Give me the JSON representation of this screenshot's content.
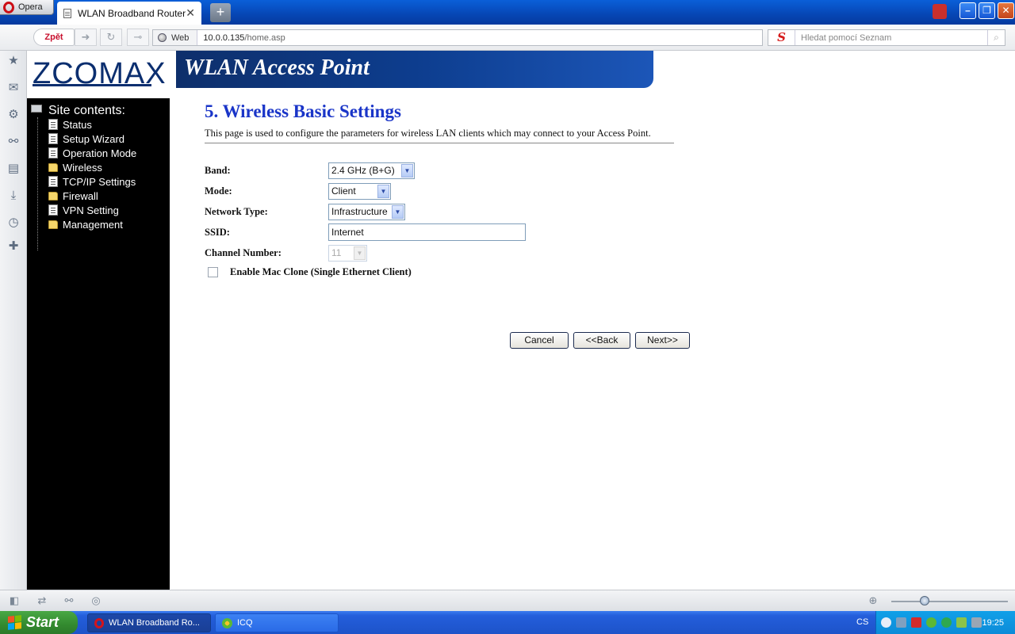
{
  "browser": {
    "menu_label": "Opera",
    "tab_title": "WLAN Broadband Router",
    "new_tab_symbol": "+",
    "back_label": "Zpět",
    "web_label": "Web",
    "url_host": "10.0.0.135",
    "url_path": "/home.asp",
    "search_placeholder": "Hledat pomocí Seznam",
    "search_engine_icon": "seznam-s-icon"
  },
  "header": {
    "logo_text": "ZCOMAX",
    "banner_title": "WLAN Access Point"
  },
  "sidebar": {
    "title": "Site contents:",
    "items": [
      {
        "label": "Status",
        "icon": "document-icon"
      },
      {
        "label": "Setup Wizard",
        "icon": "document-icon"
      },
      {
        "label": "Operation Mode",
        "icon": "document-icon"
      },
      {
        "label": "Wireless",
        "icon": "folder-icon"
      },
      {
        "label": "TCP/IP Settings",
        "icon": "document-icon"
      },
      {
        "label": "Firewall",
        "icon": "folder-icon"
      },
      {
        "label": "VPN Setting",
        "icon": "document-icon"
      },
      {
        "label": "Management",
        "icon": "folder-icon"
      }
    ]
  },
  "main": {
    "title": "5. Wireless Basic Settings",
    "description": "This page is used to configure the parameters for wireless LAN clients which may connect to your Access Point.",
    "band": {
      "label": "Band:",
      "value": "2.4 GHz (B+G)"
    },
    "mode": {
      "label": "Mode:",
      "value": "Client"
    },
    "network_type": {
      "label": "Network Type:",
      "value": "Infrastructure"
    },
    "ssid": {
      "label": "SSID:",
      "value": "Internet"
    },
    "channel": {
      "label": "Channel Number:",
      "value": "11"
    },
    "mac_clone": {
      "label": "Enable Mac Clone (Single Ethernet Client)",
      "checked": false
    },
    "buttons": {
      "cancel": "Cancel",
      "back": "<<Back",
      "next": "Next>>"
    }
  },
  "taskbar": {
    "start_label": "Start",
    "tasks": [
      "WLAN Broadband Ro...",
      "ICQ"
    ],
    "language": "CS",
    "clock": "19:25"
  },
  "colors": {
    "title_blue": "#1a35c8",
    "banner_blue": "#0d3d8e",
    "sidebar_bg": "#000000",
    "taskbar_blue": "#245edb"
  }
}
